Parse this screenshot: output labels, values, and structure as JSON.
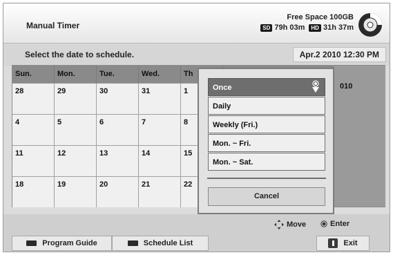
{
  "header": {
    "title": "Manual Timer",
    "free_space": "Free Space 100GB",
    "sd_badge": "SD",
    "sd_time": "79h 03m",
    "hd_badge": "HD",
    "hd_time": "31h 37m",
    "disc_icon": "disc-usage-icon"
  },
  "subheader": {
    "instruction": "Select the date to schedule.",
    "date_time": "Apr.2 2010 12:30 PM"
  },
  "calendar": {
    "day_headers": [
      "Sun.",
      "Mon.",
      "Tue.",
      "Wed.",
      "Th"
    ],
    "rows": [
      [
        "28",
        "29",
        "30",
        "31",
        "1"
      ],
      [
        "4",
        "5",
        "6",
        "7",
        "8"
      ],
      [
        "11",
        "12",
        "13",
        "14",
        "15"
      ],
      [
        "18",
        "19",
        "20",
        "21",
        "22"
      ]
    ],
    "partial_label": "010"
  },
  "popup": {
    "options": [
      "Once",
      "Daily",
      "Weekly (Fri.)",
      "Mon. ~ Fri.",
      "Mon. ~ Sat."
    ],
    "selected_index": 0,
    "cancel_label": "Cancel"
  },
  "footer": {
    "move_hint": "Move",
    "enter_hint": "Enter",
    "program_guide_label": "Program Guide",
    "schedule_list_label": "Schedule List",
    "exit_label": "Exit"
  },
  "colors": {
    "selected_option": "#6e6e6e",
    "calendar_header": "#8a8a8a",
    "background": "#dcdcdc"
  }
}
